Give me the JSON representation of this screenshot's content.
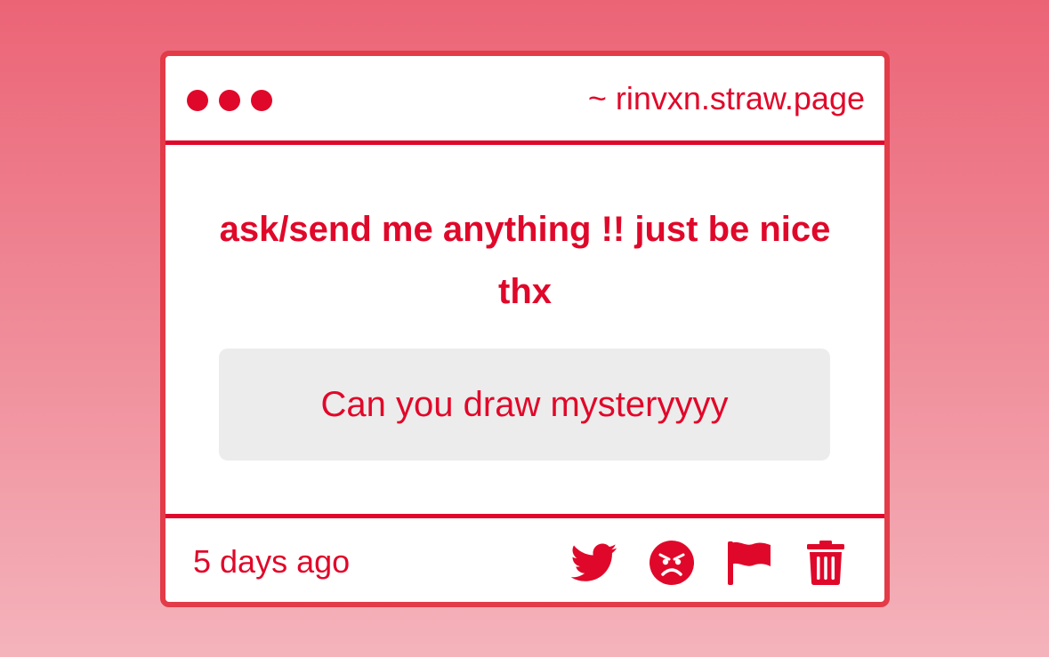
{
  "header": {
    "url": "~ rinvxn.straw.page",
    "window_dots": [
      "dot-1",
      "dot-2",
      "dot-3"
    ]
  },
  "main": {
    "prompt": "ask/send me anything !! just be nice thx",
    "message": "Can you draw mysteryyyy"
  },
  "footer": {
    "timestamp": "5 days ago",
    "actions": [
      "twitter-icon",
      "angry-face-icon",
      "flag-icon",
      "trash-icon"
    ]
  },
  "colors": {
    "accent": "#e0082a",
    "border": "#e33b48",
    "message_bg": "#edecec",
    "background_top": "#eb6476",
    "background_bottom": "#f4b3bb"
  }
}
